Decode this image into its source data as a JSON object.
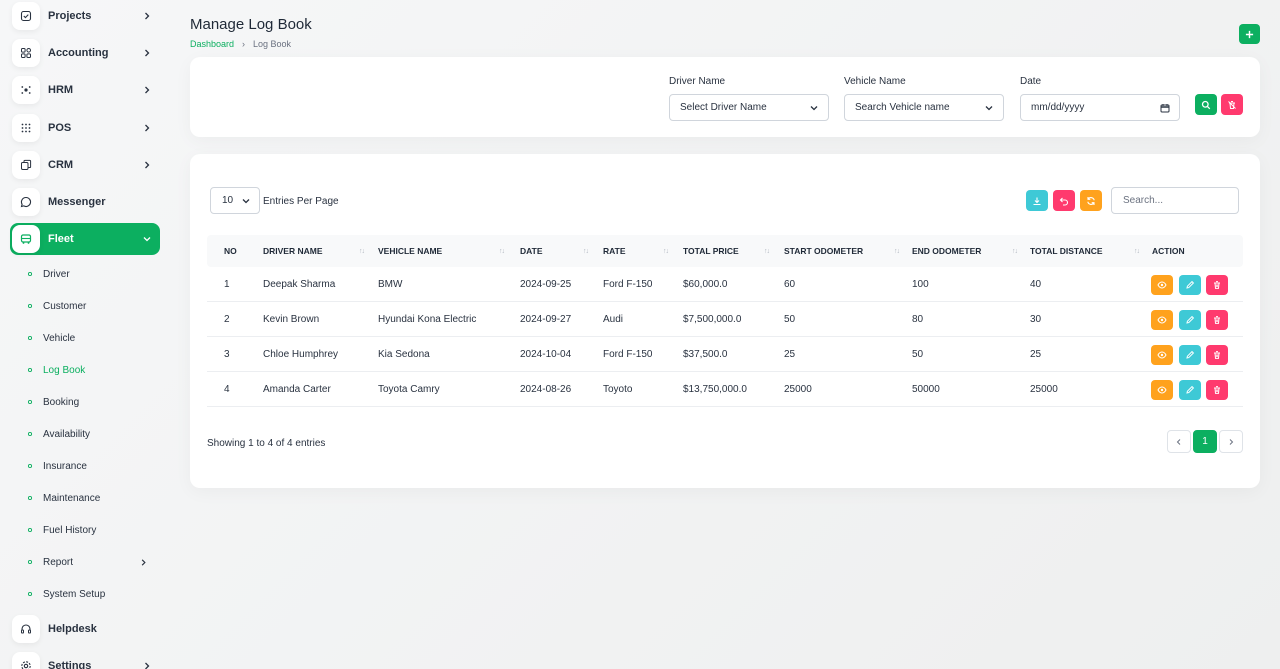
{
  "sidebar": {
    "items": [
      {
        "label": "Projects",
        "icon": "checkbox-icon",
        "has_children": true
      },
      {
        "label": "Accounting",
        "icon": "grid-icon",
        "has_children": true
      },
      {
        "label": "HRM",
        "icon": "people-icon",
        "has_children": true
      },
      {
        "label": "POS",
        "icon": "dots-grid-icon",
        "has_children": true
      },
      {
        "label": "CRM",
        "icon": "layers-icon",
        "has_children": true
      },
      {
        "label": "Messenger",
        "icon": "chat-icon",
        "has_children": false
      },
      {
        "label": "Fleet",
        "icon": "bus-icon",
        "has_children": true,
        "expanded": true
      }
    ],
    "fleet_children": [
      {
        "label": "Driver"
      },
      {
        "label": "Customer"
      },
      {
        "label": "Vehicle"
      },
      {
        "label": "Log Book",
        "current": true
      },
      {
        "label": "Booking"
      },
      {
        "label": "Availability"
      },
      {
        "label": "Insurance"
      },
      {
        "label": "Maintenance"
      },
      {
        "label": "Fuel History"
      },
      {
        "label": "Report",
        "has_children": true
      },
      {
        "label": "System Setup"
      }
    ],
    "after": [
      {
        "label": "Helpdesk",
        "icon": "headset-icon",
        "has_children": false
      },
      {
        "label": "Settings",
        "icon": "gear-icon",
        "has_children": true
      }
    ]
  },
  "header": {
    "title": "Manage Log Book",
    "breadcrumb": [
      "Dashboard",
      "Log Book"
    ]
  },
  "filters": {
    "driver_label": "Driver Name",
    "driver_value": "Select Driver Name",
    "vehicle_label": "Vehicle Name",
    "vehicle_value": "Search Vehicle name",
    "date_label": "Date",
    "date_placeholder": "mm/dd/yyyy"
  },
  "table": {
    "entries_value": "10",
    "entries_label": "Entries Per Page",
    "search_placeholder": "Search...",
    "columns": [
      "NO",
      "DRIVER NAME",
      "VEHICLE NAME",
      "DATE",
      "RATE",
      "TOTAL PRICE",
      "START ODOMETER",
      "END ODOMETER",
      "TOTAL DISTANCE",
      "ACTION"
    ],
    "rows": [
      [
        "1",
        "Deepak Sharma",
        "BMW",
        "2024-09-25",
        "Ford F-150",
        "$60,000.0",
        "60",
        "100",
        "40"
      ],
      [
        "2",
        "Kevin Brown",
        "Hyundai Kona Electric",
        "2024-09-27",
        "Audi",
        "$7,500,000.0",
        "50",
        "80",
        "30"
      ],
      [
        "3",
        "Chloe Humphrey",
        "Kia Sedona",
        "2024-10-04",
        "Ford F-150",
        "$37,500.0",
        "25",
        "50",
        "25"
      ],
      [
        "4",
        "Amanda Carter",
        "Toyota Camry",
        "2024-08-26",
        "Toyoto",
        "$13,750,000.0",
        "25000",
        "50000",
        "25000"
      ]
    ],
    "showing_text": "Showing 1 to 4 of 4 entries",
    "current_page": "1"
  },
  "colors": {
    "primary": "#0caf60",
    "danger": "#ff3a6e",
    "info": "#3ec9d6",
    "warning": "#ffa21d"
  }
}
